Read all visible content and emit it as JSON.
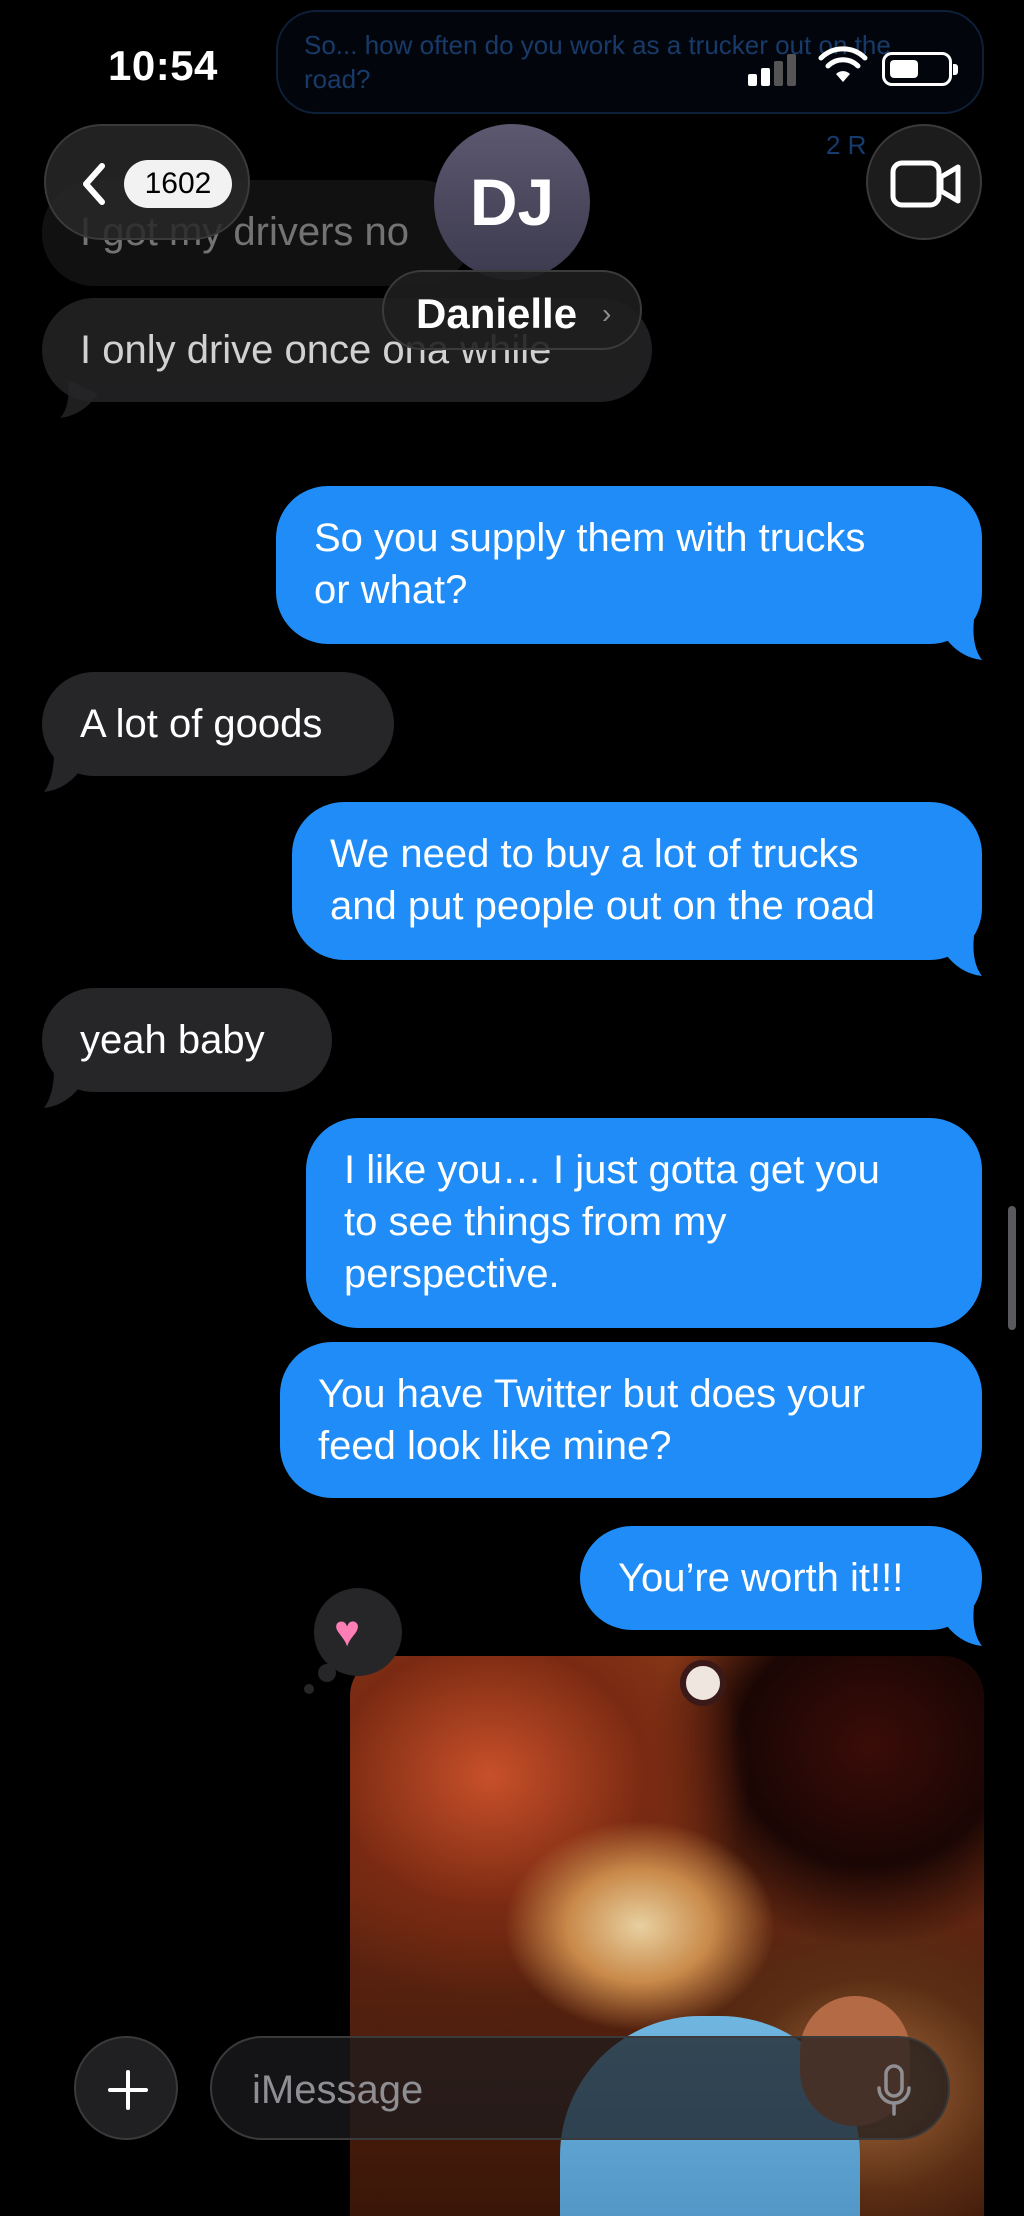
{
  "status_bar": {
    "time": "10:54"
  },
  "ghost": {
    "top_bubble_text": "So... how often do you work as a trucker out on the road?",
    "read_receipt": "2 R"
  },
  "header": {
    "back_count": "1602",
    "contact_initials": "DJ",
    "contact_name": "Danielle",
    "name_chevron": "›"
  },
  "messages": {
    "faded_in_1": "I got my drivers no",
    "faded_in_2": "I only drive once ona while",
    "out_1_line1": "So you supply them with trucks",
    "out_1_line2": "or what?",
    "in_1": "A lot of goods",
    "out_2_line1": "We need to buy a lot of trucks",
    "out_2_line2": "and put people out on the road",
    "in_2": "yeah baby",
    "out_3_line1": "I like you… I just gotta get you",
    "out_3_line2": "to see things from my",
    "out_3_line3": "perspective.",
    "out_4_line1": "You have Twitter but does your",
    "out_4_line2": "feed look like mine?",
    "out_5": "You’re worth it!!!"
  },
  "reaction": {
    "icon": "heart-icon",
    "glyph": "♥"
  },
  "input": {
    "placeholder": "iMessage"
  },
  "colors": {
    "outgoing_bubble": "#1f8cf7",
    "incoming_bubble": "#262628",
    "background": "#000000",
    "reaction_heart": "#ff7eb6"
  }
}
